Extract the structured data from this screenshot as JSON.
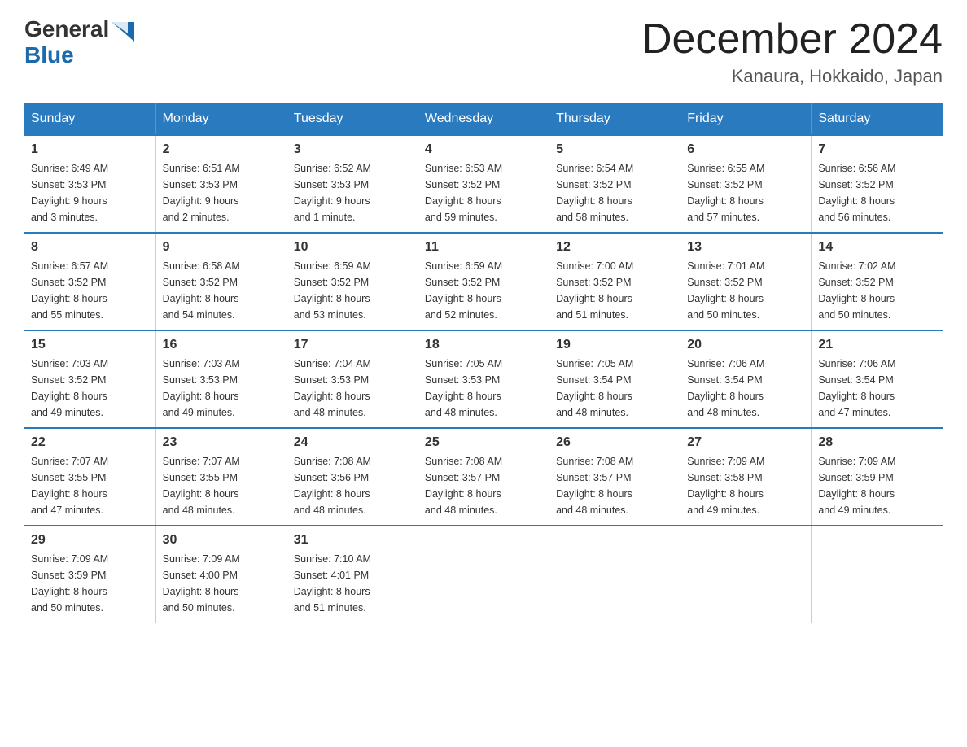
{
  "header": {
    "logo": {
      "text_general": "General",
      "text_blue": "Blue"
    },
    "title": "December 2024",
    "location": "Kanaura, Hokkaido, Japan"
  },
  "calendar": {
    "days_of_week": [
      "Sunday",
      "Monday",
      "Tuesday",
      "Wednesday",
      "Thursday",
      "Friday",
      "Saturday"
    ],
    "weeks": [
      [
        {
          "day": "1",
          "info": "Sunrise: 6:49 AM\nSunset: 3:53 PM\nDaylight: 9 hours\nand 3 minutes."
        },
        {
          "day": "2",
          "info": "Sunrise: 6:51 AM\nSunset: 3:53 PM\nDaylight: 9 hours\nand 2 minutes."
        },
        {
          "day": "3",
          "info": "Sunrise: 6:52 AM\nSunset: 3:53 PM\nDaylight: 9 hours\nand 1 minute."
        },
        {
          "day": "4",
          "info": "Sunrise: 6:53 AM\nSunset: 3:52 PM\nDaylight: 8 hours\nand 59 minutes."
        },
        {
          "day": "5",
          "info": "Sunrise: 6:54 AM\nSunset: 3:52 PM\nDaylight: 8 hours\nand 58 minutes."
        },
        {
          "day": "6",
          "info": "Sunrise: 6:55 AM\nSunset: 3:52 PM\nDaylight: 8 hours\nand 57 minutes."
        },
        {
          "day": "7",
          "info": "Sunrise: 6:56 AM\nSunset: 3:52 PM\nDaylight: 8 hours\nand 56 minutes."
        }
      ],
      [
        {
          "day": "8",
          "info": "Sunrise: 6:57 AM\nSunset: 3:52 PM\nDaylight: 8 hours\nand 55 minutes."
        },
        {
          "day": "9",
          "info": "Sunrise: 6:58 AM\nSunset: 3:52 PM\nDaylight: 8 hours\nand 54 minutes."
        },
        {
          "day": "10",
          "info": "Sunrise: 6:59 AM\nSunset: 3:52 PM\nDaylight: 8 hours\nand 53 minutes."
        },
        {
          "day": "11",
          "info": "Sunrise: 6:59 AM\nSunset: 3:52 PM\nDaylight: 8 hours\nand 52 minutes."
        },
        {
          "day": "12",
          "info": "Sunrise: 7:00 AM\nSunset: 3:52 PM\nDaylight: 8 hours\nand 51 minutes."
        },
        {
          "day": "13",
          "info": "Sunrise: 7:01 AM\nSunset: 3:52 PM\nDaylight: 8 hours\nand 50 minutes."
        },
        {
          "day": "14",
          "info": "Sunrise: 7:02 AM\nSunset: 3:52 PM\nDaylight: 8 hours\nand 50 minutes."
        }
      ],
      [
        {
          "day": "15",
          "info": "Sunrise: 7:03 AM\nSunset: 3:52 PM\nDaylight: 8 hours\nand 49 minutes."
        },
        {
          "day": "16",
          "info": "Sunrise: 7:03 AM\nSunset: 3:53 PM\nDaylight: 8 hours\nand 49 minutes."
        },
        {
          "day": "17",
          "info": "Sunrise: 7:04 AM\nSunset: 3:53 PM\nDaylight: 8 hours\nand 48 minutes."
        },
        {
          "day": "18",
          "info": "Sunrise: 7:05 AM\nSunset: 3:53 PM\nDaylight: 8 hours\nand 48 minutes."
        },
        {
          "day": "19",
          "info": "Sunrise: 7:05 AM\nSunset: 3:54 PM\nDaylight: 8 hours\nand 48 minutes."
        },
        {
          "day": "20",
          "info": "Sunrise: 7:06 AM\nSunset: 3:54 PM\nDaylight: 8 hours\nand 48 minutes."
        },
        {
          "day": "21",
          "info": "Sunrise: 7:06 AM\nSunset: 3:54 PM\nDaylight: 8 hours\nand 47 minutes."
        }
      ],
      [
        {
          "day": "22",
          "info": "Sunrise: 7:07 AM\nSunset: 3:55 PM\nDaylight: 8 hours\nand 47 minutes."
        },
        {
          "day": "23",
          "info": "Sunrise: 7:07 AM\nSunset: 3:55 PM\nDaylight: 8 hours\nand 48 minutes."
        },
        {
          "day": "24",
          "info": "Sunrise: 7:08 AM\nSunset: 3:56 PM\nDaylight: 8 hours\nand 48 minutes."
        },
        {
          "day": "25",
          "info": "Sunrise: 7:08 AM\nSunset: 3:57 PM\nDaylight: 8 hours\nand 48 minutes."
        },
        {
          "day": "26",
          "info": "Sunrise: 7:08 AM\nSunset: 3:57 PM\nDaylight: 8 hours\nand 48 minutes."
        },
        {
          "day": "27",
          "info": "Sunrise: 7:09 AM\nSunset: 3:58 PM\nDaylight: 8 hours\nand 49 minutes."
        },
        {
          "day": "28",
          "info": "Sunrise: 7:09 AM\nSunset: 3:59 PM\nDaylight: 8 hours\nand 49 minutes."
        }
      ],
      [
        {
          "day": "29",
          "info": "Sunrise: 7:09 AM\nSunset: 3:59 PM\nDaylight: 8 hours\nand 50 minutes."
        },
        {
          "day": "30",
          "info": "Sunrise: 7:09 AM\nSunset: 4:00 PM\nDaylight: 8 hours\nand 50 minutes."
        },
        {
          "day": "31",
          "info": "Sunrise: 7:10 AM\nSunset: 4:01 PM\nDaylight: 8 hours\nand 51 minutes."
        },
        {
          "day": "",
          "info": ""
        },
        {
          "day": "",
          "info": ""
        },
        {
          "day": "",
          "info": ""
        },
        {
          "day": "",
          "info": ""
        }
      ]
    ]
  }
}
